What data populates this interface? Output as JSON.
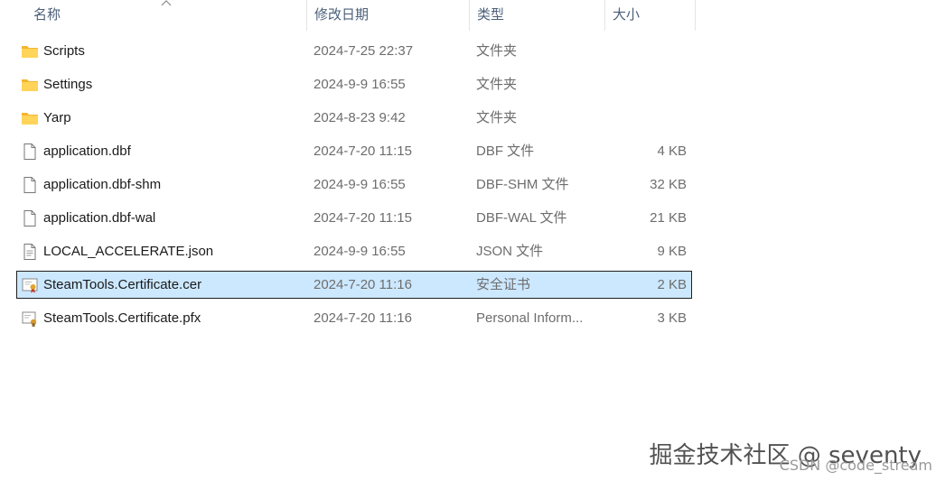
{
  "columns": {
    "name": "名称",
    "date": "修改日期",
    "type": "类型",
    "size": "大小"
  },
  "files": [
    {
      "name": "Scripts",
      "date": "2024-7-25 22:37",
      "type": "文件夹",
      "size": "",
      "icon": "folder-icon"
    },
    {
      "name": "Settings",
      "date": "2024-9-9 16:55",
      "type": "文件夹",
      "size": "",
      "icon": "folder-icon"
    },
    {
      "name": "Yarp",
      "date": "2024-8-23 9:42",
      "type": "文件夹",
      "size": "",
      "icon": "folder-icon"
    },
    {
      "name": "application.dbf",
      "date": "2024-7-20 11:15",
      "type": "DBF 文件",
      "size": "4 KB",
      "icon": "file-icon"
    },
    {
      "name": "application.dbf-shm",
      "date": "2024-9-9 16:55",
      "type": "DBF-SHM 文件",
      "size": "32 KB",
      "icon": "file-icon"
    },
    {
      "name": "application.dbf-wal",
      "date": "2024-7-20 11:15",
      "type": "DBF-WAL 文件",
      "size": "21 KB",
      "icon": "file-icon"
    },
    {
      "name": "LOCAL_ACCELERATE.json",
      "date": "2024-9-9 16:55",
      "type": "JSON 文件",
      "size": "9 KB",
      "icon": "json-file-icon"
    },
    {
      "name": "SteamTools.Certificate.cer",
      "date": "2024-7-20 11:16",
      "type": "安全证书",
      "size": "2 KB",
      "icon": "certificate-icon",
      "selected": true
    },
    {
      "name": "SteamTools.Certificate.pfx",
      "date": "2024-7-20 11:16",
      "type": "Personal Inform...",
      "size": "3 KB",
      "icon": "pfx-certificate-icon"
    }
  ],
  "watermark": "掘金技术社区 @ seventy",
  "watermark_sub": "CSDN @code_stream",
  "colors": {
    "selection_bg": "#cce8ff",
    "folder": "#f8c94a",
    "header_text": "#4c607a"
  }
}
